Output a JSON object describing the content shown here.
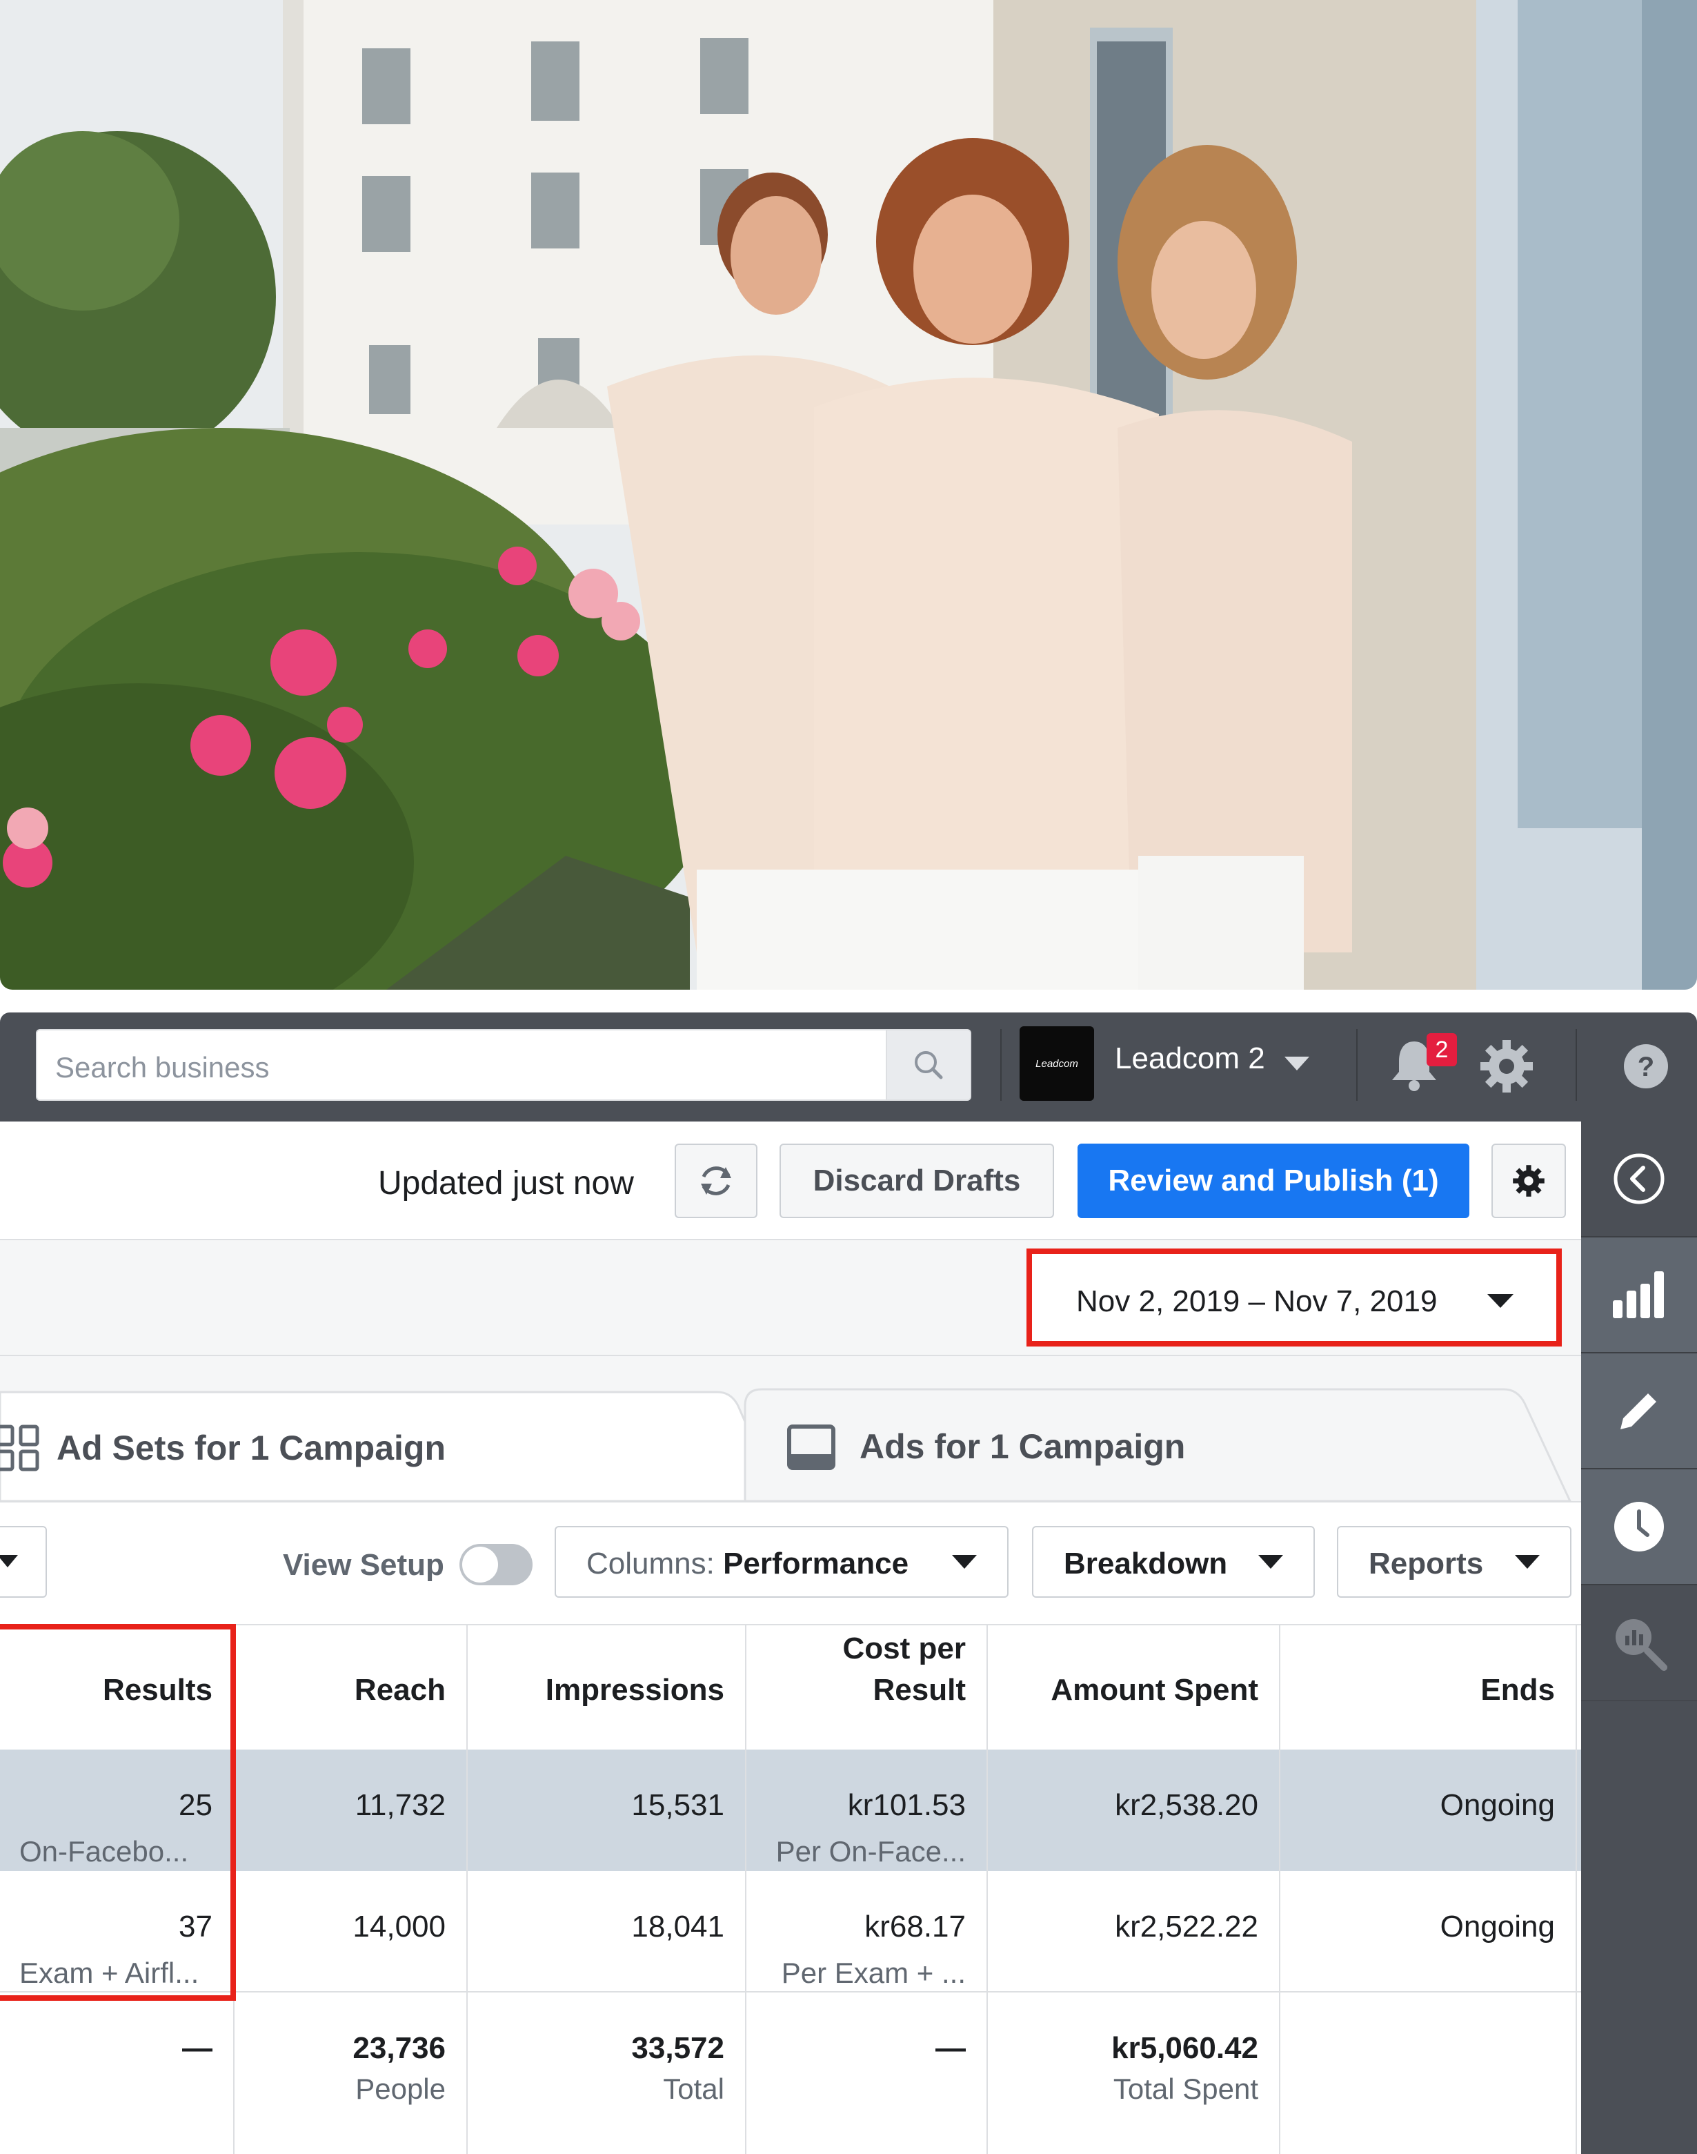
{
  "topbar": {
    "search_placeholder": "Search business",
    "account_logo_text": "Leadcom",
    "account_name": "Leadcom 2",
    "notifications_count": "2"
  },
  "toolbar": {
    "updated_text": "Updated just now",
    "discard_label": "Discard Drafts",
    "publish_label": "Review and Publish (1)"
  },
  "date_range": "Nov 2, 2019 – Nov 7, 2019",
  "tabs": [
    {
      "label": "Ad Sets for 1 Campaign"
    },
    {
      "label": "Ads for 1 Campaign"
    }
  ],
  "filters": {
    "view_setup_label": "View Setup",
    "columns_prefix": "Columns: ",
    "columns_value": "Performance",
    "breakdown_label": "Breakdown",
    "reports_label": "Reports"
  },
  "table": {
    "headers": [
      "Results",
      "Reach",
      "Impressions",
      "Cost per Result",
      "Amount Spent",
      "Ends"
    ],
    "cost_header_line1": "Cost per",
    "cost_header_line2": "Result",
    "rows": [
      {
        "results": "25",
        "results_sub": "On-Facebo...",
        "reach": "11,732",
        "impressions": "15,531",
        "cost": "kr101.53",
        "cost_sub": "Per On-Face...",
        "spent": "kr2,538.20",
        "ends": "Ongoing"
      },
      {
        "results": "37",
        "results_sub": "Exam + Airfl...",
        "reach": "14,000",
        "impressions": "18,041",
        "cost": "kr68.17",
        "cost_sub": "Per Exam + ...",
        "spent": "kr2,522.22",
        "ends": "Ongoing"
      }
    ],
    "totals": {
      "results": "—",
      "reach": "23,736",
      "reach_sub": "People",
      "impressions": "33,572",
      "impressions_sub": "Total",
      "cost": "—",
      "spent": "kr5,060.42",
      "spent_sub": "Total Spent"
    }
  },
  "colors": {
    "accent_blue": "#1877f2",
    "highlight_red": "#e8221a",
    "topbar_bg": "#4b4f56",
    "selected_row_bg": "#ced7e0"
  }
}
